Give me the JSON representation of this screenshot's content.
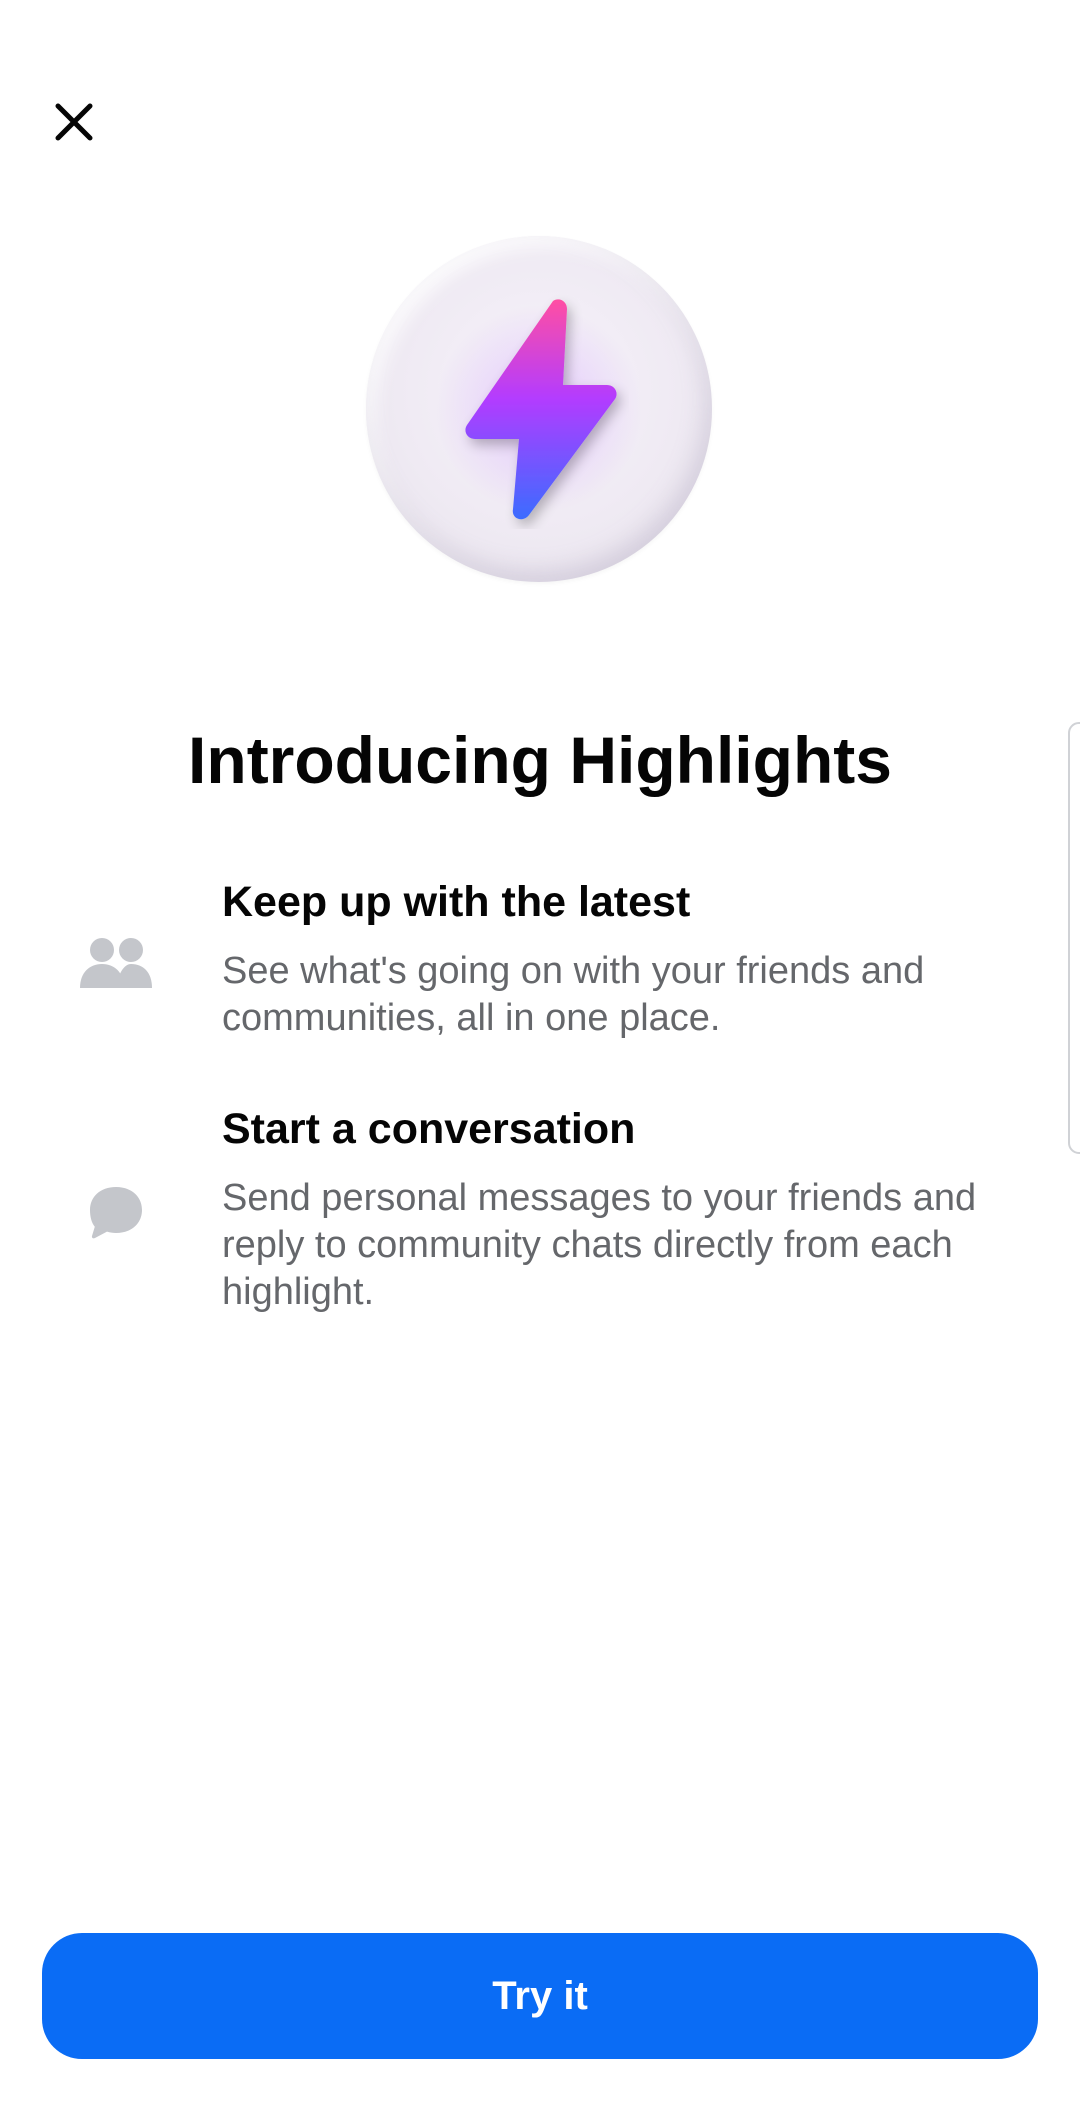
{
  "header": {
    "close_icon": "close-icon"
  },
  "hero": {
    "icon": "lightning-bolt-icon",
    "colors": {
      "bolt_top": "#ff4fa3",
      "bolt_mid": "#b33cff",
      "bolt_bottom": "#3b6cff"
    }
  },
  "main": {
    "title": "Introducing Highlights",
    "features": [
      {
        "icon": "people-icon",
        "title": "Keep up with the latest",
        "description": "See what's going on with your friends and communities, all in one place."
      },
      {
        "icon": "chat-bubble-icon",
        "title": "Start a conversation",
        "description": "Send personal messages to your friends and reply to community chats directly from each highlight."
      }
    ]
  },
  "footer": {
    "cta_label": "Try it",
    "cta_color": "#0a6cf5"
  }
}
